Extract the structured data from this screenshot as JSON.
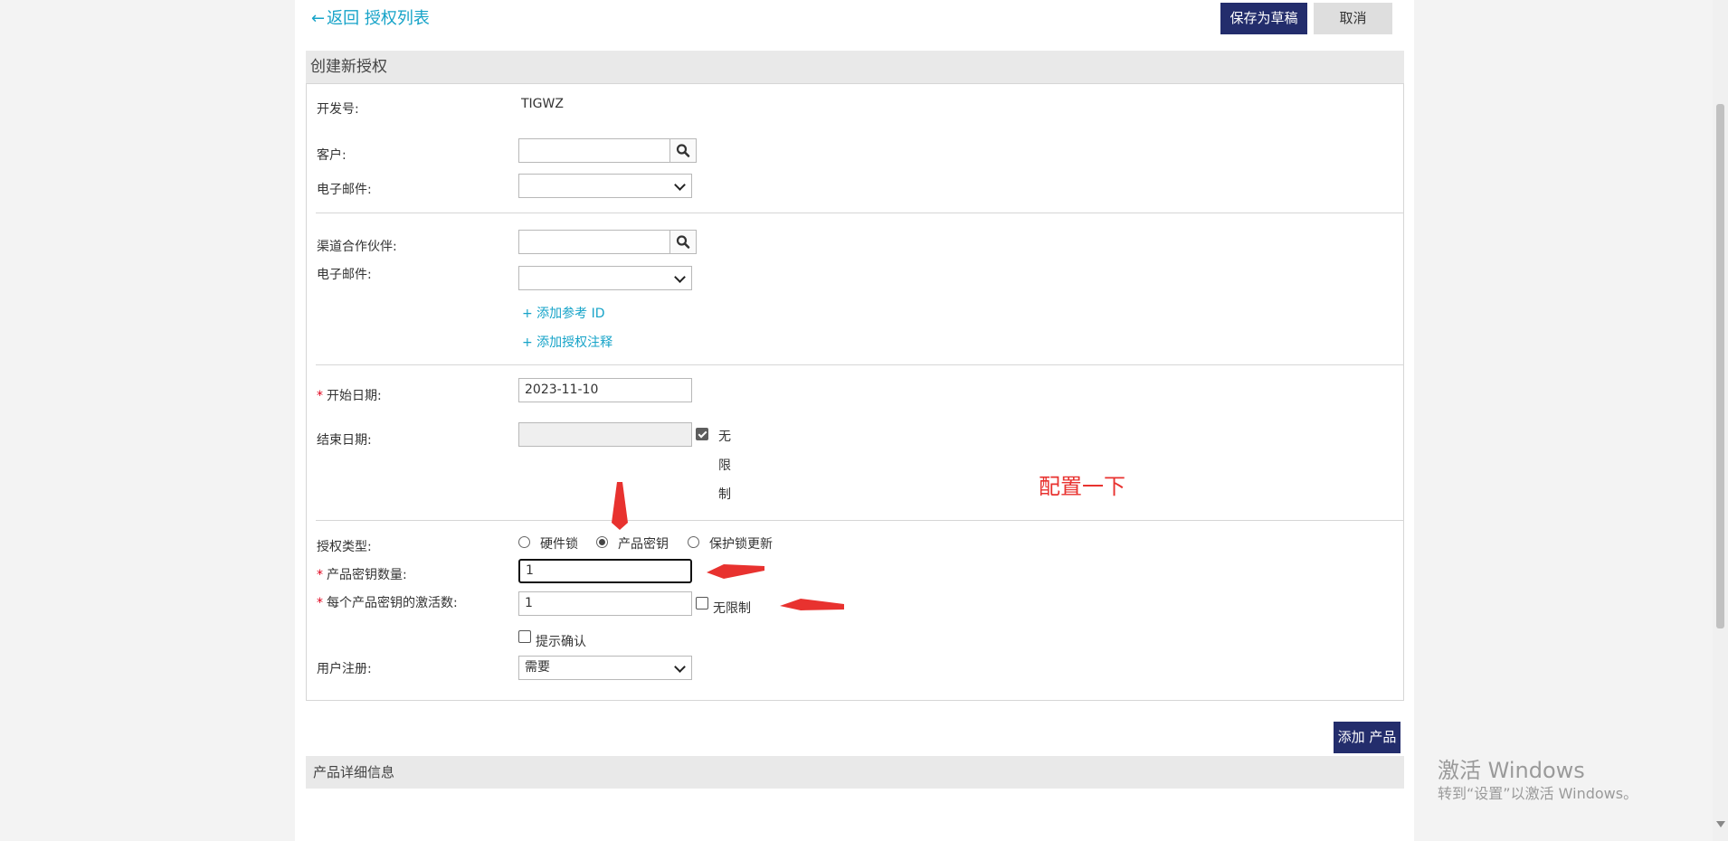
{
  "nav": {
    "back_label": "返回 授权列表"
  },
  "toolbar": {
    "save_draft": "保存为草稿",
    "cancel": "取消"
  },
  "section": {
    "title": "创建新授权"
  },
  "form": {
    "dev_id_label": "开发号:",
    "dev_id_value": "TIGWZ",
    "customer_label": "客户:",
    "customer_value": "",
    "customer_email_label": "电子邮件:",
    "customer_email_value": "",
    "channel_partner_label": "渠道合作伙伴:",
    "channel_partner_value": "",
    "partner_email_label": "电子邮件:",
    "partner_email_value": "",
    "add_reference_id": "+ 添加参考 ID",
    "add_entitlement_note": "+ 添加授权注释",
    "required_mark": "*",
    "start_date_label": "开始日期:",
    "start_date_value": "2023-11-10",
    "end_date_label": "结束日期:",
    "end_date_value": "",
    "end_unlimited_label": [
      "无",
      "限",
      "制"
    ],
    "end_unlimited_checked": true,
    "license_type_label": "授权类型:",
    "license_types": [
      {
        "label": "硬件锁",
        "selected": false
      },
      {
        "label": "产品密钥",
        "selected": true
      },
      {
        "label": "保护锁更新",
        "selected": false
      }
    ],
    "key_quantity_label": "产品密钥数量:",
    "key_quantity_value": "1",
    "activations_label": "每个产品密钥的激活数:",
    "activations_value": "1",
    "activations_unlimited_label": "无限制",
    "activations_unlimited_checked": false,
    "prompt_confirm_label": "提示确认",
    "prompt_confirm_checked": false,
    "user_registration_label": "用户注册:",
    "user_registration_value": "需要"
  },
  "annotation": {
    "text": "配置一下",
    "color": "#e8322f"
  },
  "products": {
    "add_button": "添加 产品",
    "section_title": "产品详细信息"
  },
  "watermark": {
    "title": "激活 Windows",
    "subtitle": "转到“设置”以激活 Windows。"
  },
  "colors": {
    "accent": "#16a3c8",
    "primary_button": "#232d6c",
    "required": "#e0001b"
  }
}
